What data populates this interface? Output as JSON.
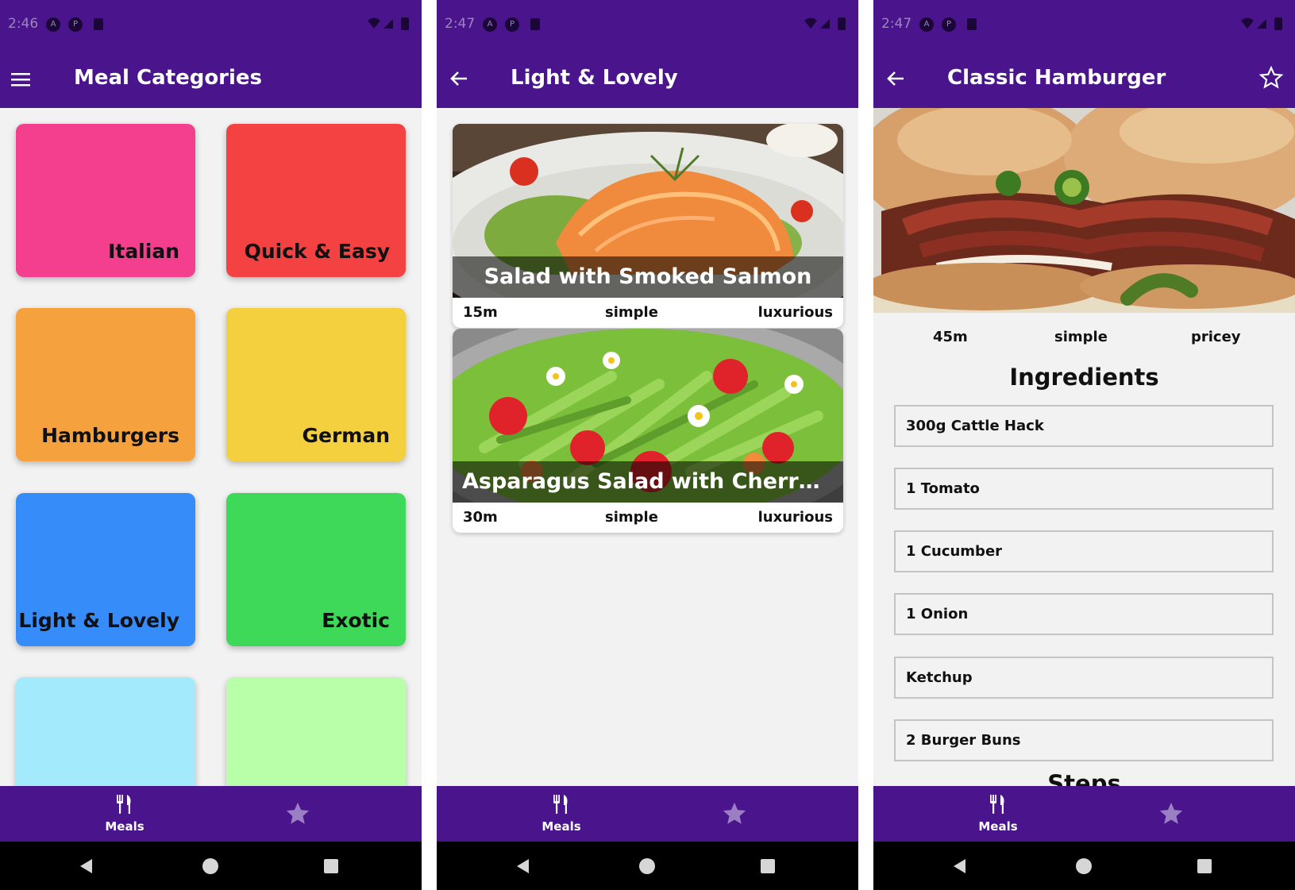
{
  "status": {
    "time1": "2:46",
    "time2": "2:47",
    "time3": "2:47"
  },
  "screen1": {
    "title": "Meal Categories",
    "categories": [
      {
        "label": "Italian",
        "color": "#f33f8e"
      },
      {
        "label": "Quick & Easy",
        "color": "#f44242"
      },
      {
        "label": "Hamburgers",
        "color": "#f5a23e"
      },
      {
        "label": "German",
        "color": "#f5d03e"
      },
      {
        "label": "Light & Lovely",
        "color": "#368cf9"
      },
      {
        "label": "Exotic",
        "color": "#3fd95a"
      },
      {
        "label": "",
        "color": "#a3ebfc"
      },
      {
        "label": "",
        "color": "#b9fea8"
      }
    ]
  },
  "screen2": {
    "title": "Light & Lovely",
    "meals": [
      {
        "title": "Salad with Smoked Salmon",
        "duration": "15m",
        "complexity": "simple",
        "affordability": "luxurious"
      },
      {
        "title": "Asparagus Salad with Cherry To..",
        "duration": "30m",
        "complexity": "simple",
        "affordability": "luxurious"
      }
    ]
  },
  "screen3": {
    "title": "Classic Hamburger",
    "duration": "45m",
    "complexity": "simple",
    "affordability": "pricey",
    "ingredients_heading": "Ingredients",
    "ingredients": [
      "300g Cattle Hack",
      "1 Tomato",
      "1 Cucumber",
      "1 Onion",
      "Ketchup",
      "2 Burger Buns"
    ],
    "steps_heading": "Steps"
  },
  "bottom_nav": {
    "meals_label": "Meals",
    "meals_icon": "cutlery-icon",
    "favorites_icon": "star-icon"
  },
  "colors": {
    "primary": "#4a148c",
    "background": "#f2f2f2",
    "inactive_tab": "#9a7fc4"
  }
}
